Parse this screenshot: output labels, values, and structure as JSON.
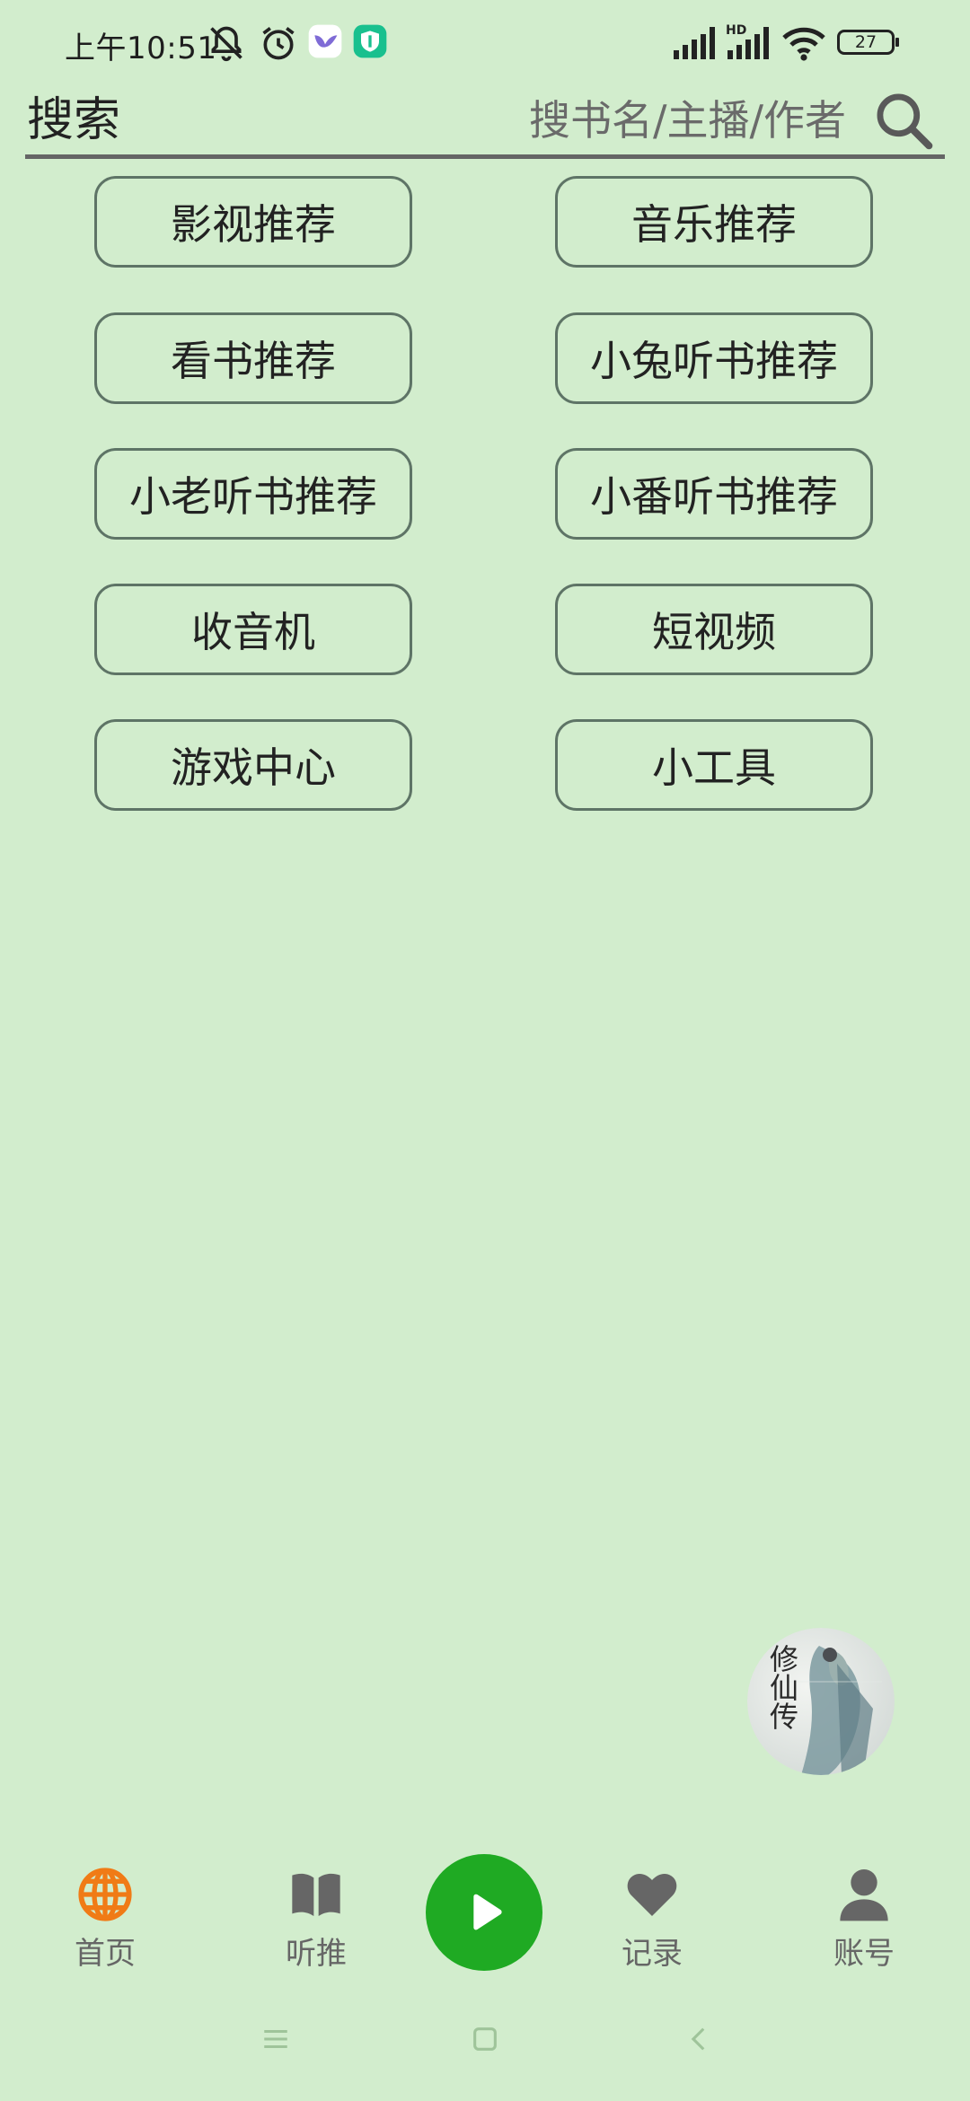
{
  "status_bar": {
    "time": "上午10:51",
    "battery": "27",
    "network_badge": "HD"
  },
  "search": {
    "title": "搜索",
    "placeholder": "搜书名/主播/作者"
  },
  "categories": [
    {
      "label": "影视推荐"
    },
    {
      "label": "音乐推荐"
    },
    {
      "label": "看书推荐"
    },
    {
      "label": "小兔听书推荐"
    },
    {
      "label": "小老听书推荐"
    },
    {
      "label": "小番听书推荐"
    },
    {
      "label": "收音机"
    },
    {
      "label": "短视频"
    },
    {
      "label": "游戏中心"
    },
    {
      "label": "小工具"
    }
  ],
  "float_cover": {
    "text": "修仙传"
  },
  "bottom_nav": {
    "items": [
      {
        "label": "首页",
        "icon": "globe-icon"
      },
      {
        "label": "听推",
        "icon": "book-icon"
      },
      {
        "label": "记录",
        "icon": "heart-icon"
      },
      {
        "label": "账号",
        "icon": "user-icon"
      }
    ],
    "play_icon": "play-icon"
  },
  "colors": {
    "background": "#d2edcd",
    "accent_play": "#1faa23",
    "active_icon": "#f07b16",
    "inactive": "#666666"
  }
}
